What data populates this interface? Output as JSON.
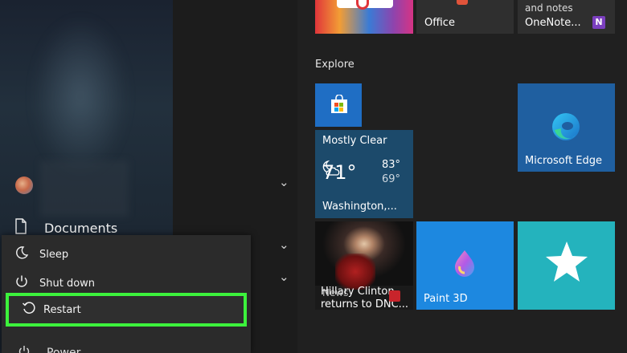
{
  "top_tiles": {
    "office_label": "Office",
    "onenote_line1": "and notes",
    "onenote_line2": "OneNote..."
  },
  "explore": {
    "header": "Explore",
    "weather": {
      "condition": "Mostly Clear",
      "temp": "71°",
      "high": "83°",
      "low": "69°",
      "city": "Washington,..."
    },
    "edge_label": "Microsoft Edge",
    "news": {
      "headline_line1": "Hillary Clinton",
      "headline_line2": "returns to DNC...",
      "source": "News"
    },
    "paint_label": "Paint 3D"
  },
  "left_rail": {
    "documents_label": "Documents",
    "partial_label": "Power"
  },
  "power_menu": {
    "items": [
      {
        "label": "Sleep",
        "icon": "moon-icon"
      },
      {
        "label": "Shut down",
        "icon": "power-icon"
      },
      {
        "label": "Restart",
        "icon": "restart-icon"
      }
    ]
  },
  "colors": {
    "highlight": "#3cf23c",
    "edge_tile": "#1f5fa0",
    "paint_tile": "#1d88e0",
    "star_tile": "#24b3bd"
  }
}
